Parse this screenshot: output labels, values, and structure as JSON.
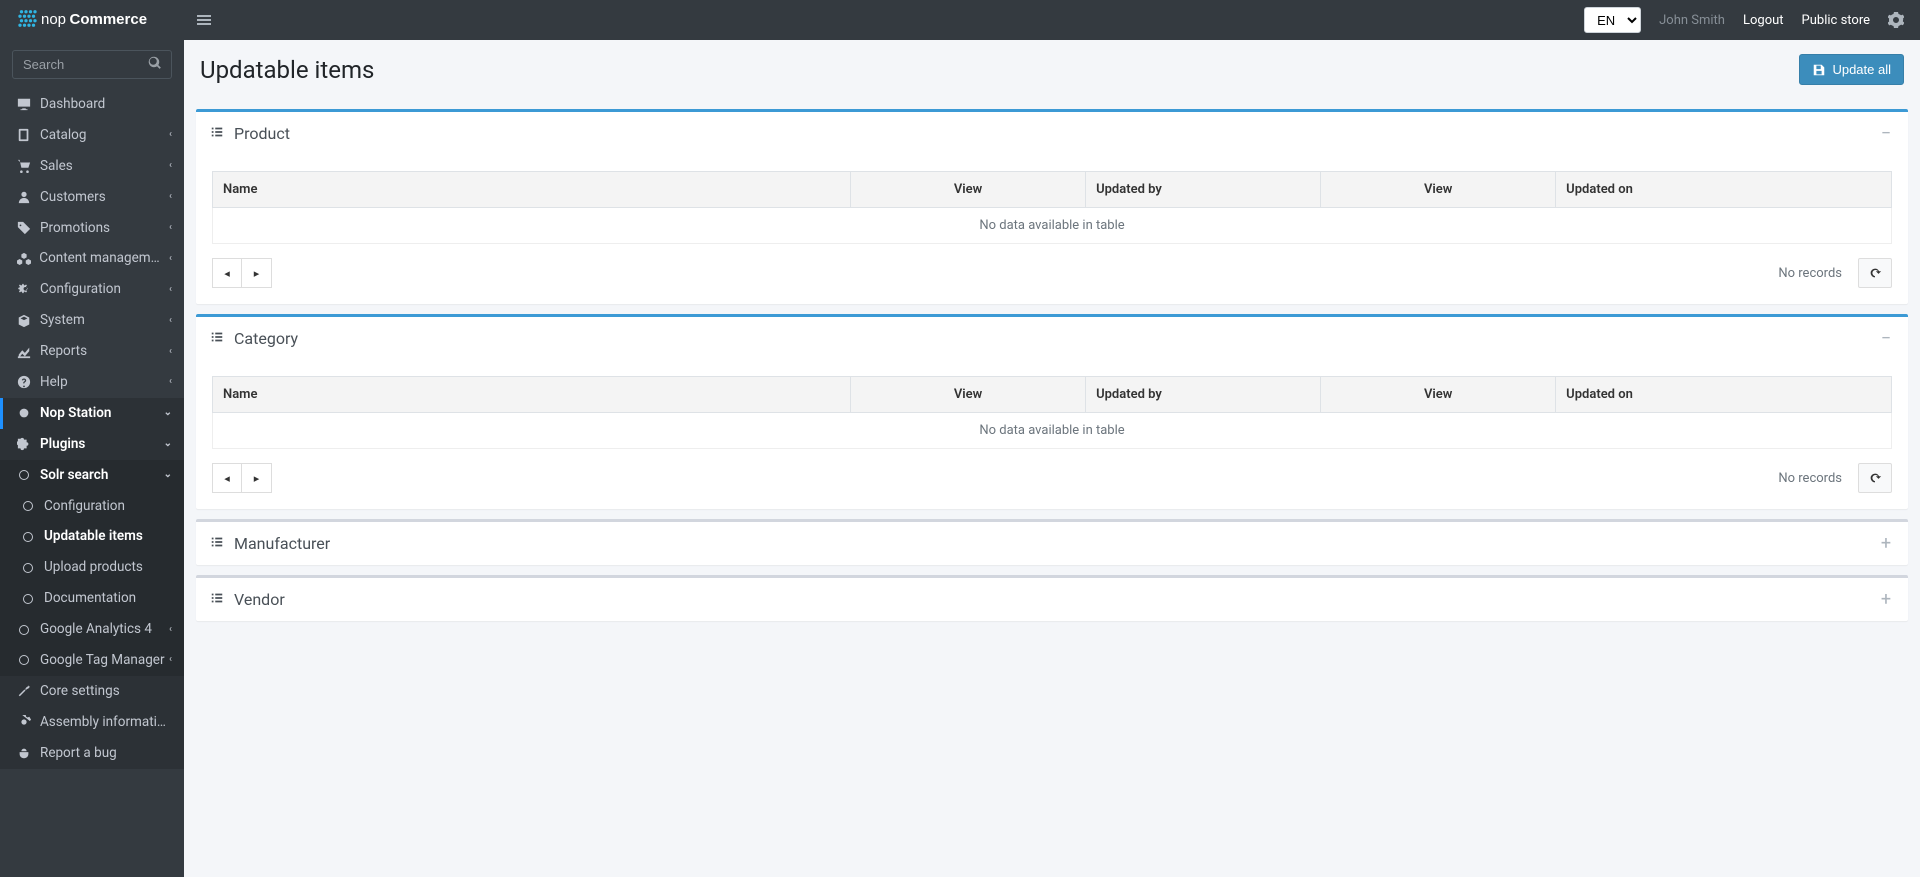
{
  "navbar": {
    "logo_text": "nopCommerce",
    "languages": [
      "EN"
    ],
    "selected_language": "EN",
    "username": "John Smith",
    "logout": "Logout",
    "public_store": "Public store"
  },
  "sidebar": {
    "search_placeholder": "Search",
    "items": [
      {
        "icon": "desktop",
        "label": "Dashboard",
        "expandable": false
      },
      {
        "icon": "book",
        "label": "Catalog",
        "expandable": true
      },
      {
        "icon": "cart",
        "label": "Sales",
        "expandable": true
      },
      {
        "icon": "user",
        "label": "Customers",
        "expandable": true
      },
      {
        "icon": "tags",
        "label": "Promotions",
        "expandable": true
      },
      {
        "icon": "cubes",
        "label": "Content management",
        "expandable": true
      },
      {
        "icon": "cogs",
        "label": "Configuration",
        "expandable": true
      },
      {
        "icon": "cube",
        "label": "System",
        "expandable": true
      },
      {
        "icon": "chart",
        "label": "Reports",
        "expandable": true
      },
      {
        "icon": "question",
        "label": "Help",
        "expandable": true
      }
    ],
    "nop_station": {
      "label": "Nop Station",
      "plugins_label": "Plugins",
      "solr": {
        "label": "Solr search",
        "children": [
          {
            "label": "Configuration",
            "active": false
          },
          {
            "label": "Updatable items",
            "active": true
          },
          {
            "label": "Upload products",
            "active": false
          },
          {
            "label": "Documentation",
            "active": false
          }
        ]
      },
      "ga4_label": "Google Analytics 4",
      "gtm_label": "Google Tag Manager",
      "core_settings": "Core settings",
      "assembly_info": "Assembly information",
      "report_bug": "Report a bug"
    }
  },
  "page": {
    "title": "Updatable items",
    "update_all_label": "Update all"
  },
  "columns": {
    "name": "Name",
    "view": "View",
    "updated_by": "Updated by",
    "updated_on": "Updated on"
  },
  "table": {
    "empty": "No data available in table",
    "no_records": "No records"
  },
  "panels": [
    {
      "title": "Product",
      "open": true
    },
    {
      "title": "Category",
      "open": true
    },
    {
      "title": "Manufacturer",
      "open": false
    },
    {
      "title": "Vendor",
      "open": false
    }
  ]
}
